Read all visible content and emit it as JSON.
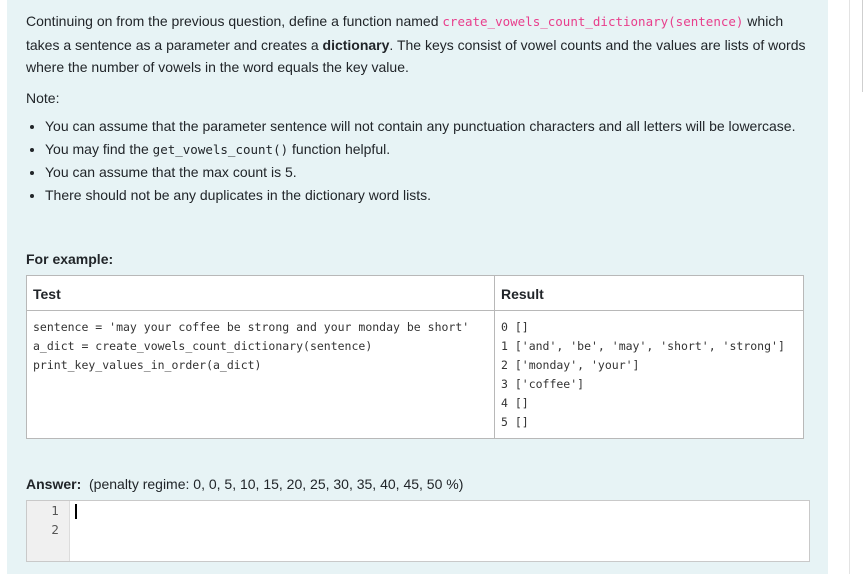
{
  "question": {
    "intro_before": "Continuing on from the previous question, define a function named ",
    "function_sig": "create_vowels_count_dictionary(sentence)",
    "intro_mid": " which takes a sentence as a parameter and creates a ",
    "dictionary_word": "dictionary",
    "intro_after": ". The keys consist of vowel counts and the values are lists of words where the number of vowels in the word equals the key value.",
    "note_label": "Note:",
    "bullets": [
      {
        "before": "You can assume that the parameter sentence will not contain any punctuation characters and all letters will be lowercase.",
        "code": "",
        "after": ""
      },
      {
        "before": "You may find the ",
        "code": "get_vowels_count()",
        "after": " function helpful."
      },
      {
        "before": "You can assume that the max count is 5.",
        "code": "",
        "after": ""
      },
      {
        "before": "There should not be any duplicates in the dictionary word lists.",
        "code": "",
        "after": ""
      }
    ]
  },
  "example": {
    "label": "For example:",
    "headers": {
      "test": "Test",
      "result": "Result"
    },
    "test_code": "sentence = 'may your coffee be strong and your monday be short'\na_dict = create_vowels_count_dictionary(sentence)\nprint_key_values_in_order(a_dict)",
    "result_code": "0 []\n1 ['and', 'be', 'may', 'short', 'strong']\n2 ['monday', 'your']\n3 ['coffee']\n4 []\n5 []"
  },
  "answer": {
    "label": "Answer:",
    "penalty": "(penalty regime: 0, 0, 5, 10, 15, 20, 25, 30, 35, 40, 45, 50 %)",
    "line_numbers": [
      "1",
      "2"
    ]
  }
}
